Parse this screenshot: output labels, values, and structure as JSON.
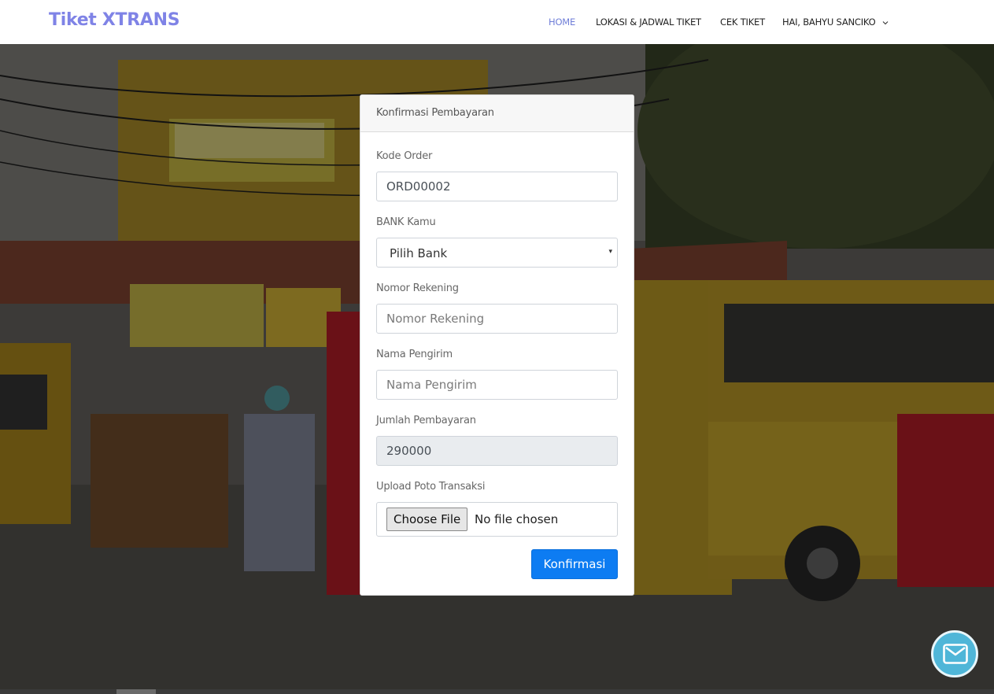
{
  "brand": {
    "title": "Tiket XTRANS",
    "color": "#7f83e6"
  },
  "nav": {
    "home": "HOME",
    "lokasi": "LOKASI & JADWAL TIKET",
    "cek": "CEK TIKET",
    "user": "HAI, BAHYU SANCIKO",
    "active_color": "#6f7ed8"
  },
  "form": {
    "header": "Konfirmasi Pembayaran",
    "kode_order": {
      "label": "Kode Order",
      "value": "ORD00002"
    },
    "bank": {
      "label": "BANK Kamu",
      "selected": "Pilih Bank"
    },
    "nomor_rekening": {
      "label": "Nomor Rekening",
      "placeholder": "Nomor Rekening"
    },
    "nama_pengirim": {
      "label": "Nama Pengirim",
      "placeholder": "Nama Pengirim"
    },
    "jumlah": {
      "label": "Jumlah Pembayaran",
      "value": "290000"
    },
    "upload": {
      "label": "Upload Poto Transaksi",
      "button": "Choose File",
      "status": "No file chosen"
    },
    "submit": "Konfirmasi",
    "submit_color": "#0d7cf2"
  },
  "chat": {
    "icon": "mail-icon",
    "color": "#4fb6d8"
  }
}
